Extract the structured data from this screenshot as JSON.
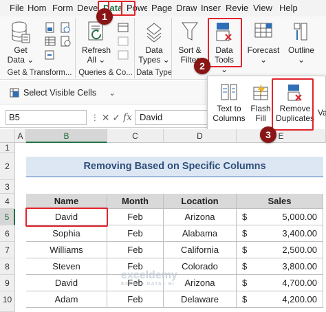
{
  "tabs": [
    {
      "label": "File",
      "active": false
    },
    {
      "label": "Hom",
      "active": false
    },
    {
      "label": "Form",
      "active": false
    },
    {
      "label": "Deve",
      "active": false
    },
    {
      "label": "Data",
      "active": true
    },
    {
      "label": "Powe",
      "active": false
    },
    {
      "label": "Page",
      "active": false
    },
    {
      "label": "Draw",
      "active": false
    },
    {
      "label": "Inser",
      "active": false
    },
    {
      "label": "Revie",
      "active": false
    },
    {
      "label": "View",
      "active": false
    },
    {
      "label": "Help",
      "active": false
    }
  ],
  "ribbon": {
    "get_data": {
      "line1": "Get",
      "line2": "Data ⌄"
    },
    "get_transform_label": "Get & Transform...",
    "refresh": {
      "line1": "Refresh",
      "line2": "All ⌄"
    },
    "queries_label": "Queries & Co...",
    "data_types": {
      "line1": "Data",
      "line2": "Types ⌄"
    },
    "data_types_label": "Data Types",
    "sort_filter": {
      "line1": "Sort &",
      "line2": "Filter"
    },
    "data_tools": {
      "line1": "Data",
      "line2": "Tools ⌄"
    },
    "forecast": {
      "line1": "Forecast",
      "line2": "⌄"
    },
    "outline": {
      "line1": "Outline",
      "line2": "⌄"
    }
  },
  "quick_access": {
    "select_visible": "Select Visible Cells",
    "more_icon": "customize-icon"
  },
  "dropdown": {
    "text_to_columns": {
      "line1": "Text to",
      "line2": "Columns"
    },
    "flash_fill": {
      "line1": "Flash",
      "line2": "Fill"
    },
    "remove_duplicates": {
      "line1": "Remove",
      "line2": "Duplicates"
    },
    "validation_partial": "Vali"
  },
  "formula_bar": {
    "name_box": "B5",
    "fx": "fx",
    "value": "David"
  },
  "grid": {
    "columns": [
      "A",
      "B",
      "C",
      "D",
      "E"
    ],
    "rows": [
      "1",
      "2",
      "3",
      "4",
      "5",
      "6",
      "7",
      "8",
      "9",
      "10"
    ],
    "title": "Removing Based on Specific Columns",
    "headers": [
      "Name",
      "Month",
      "Location",
      "Sales"
    ],
    "data": [
      {
        "name": "David",
        "month": "Feb",
        "location": "Arizona",
        "currency": "$",
        "sales": "5,000.00"
      },
      {
        "name": "Sophia",
        "month": "Feb",
        "location": "Alabama",
        "currency": "$",
        "sales": "3,400.00"
      },
      {
        "name": "Williams",
        "month": "Feb",
        "location": "California",
        "currency": "$",
        "sales": "2,500.00"
      },
      {
        "name": "Steven",
        "month": "Feb",
        "location": "Colorado",
        "currency": "$",
        "sales": "3,800.00"
      },
      {
        "name": "David",
        "month": "Feb",
        "location": "Arizona",
        "currency": "$",
        "sales": "4,700.00"
      },
      {
        "name": "Adam",
        "month": "Feb",
        "location": "Delaware",
        "currency": "$",
        "sales": "4,200.00"
      }
    ]
  },
  "callouts": [
    "1",
    "2",
    "3"
  ],
  "watermark": {
    "brand": "exceldemy",
    "tagline": "EXCEL · DATA · BI"
  },
  "colors": {
    "accent_green": "#217346",
    "callout_red": "#e1232b",
    "badge": "#8a1515",
    "title_fill": "#dde7f4"
  }
}
